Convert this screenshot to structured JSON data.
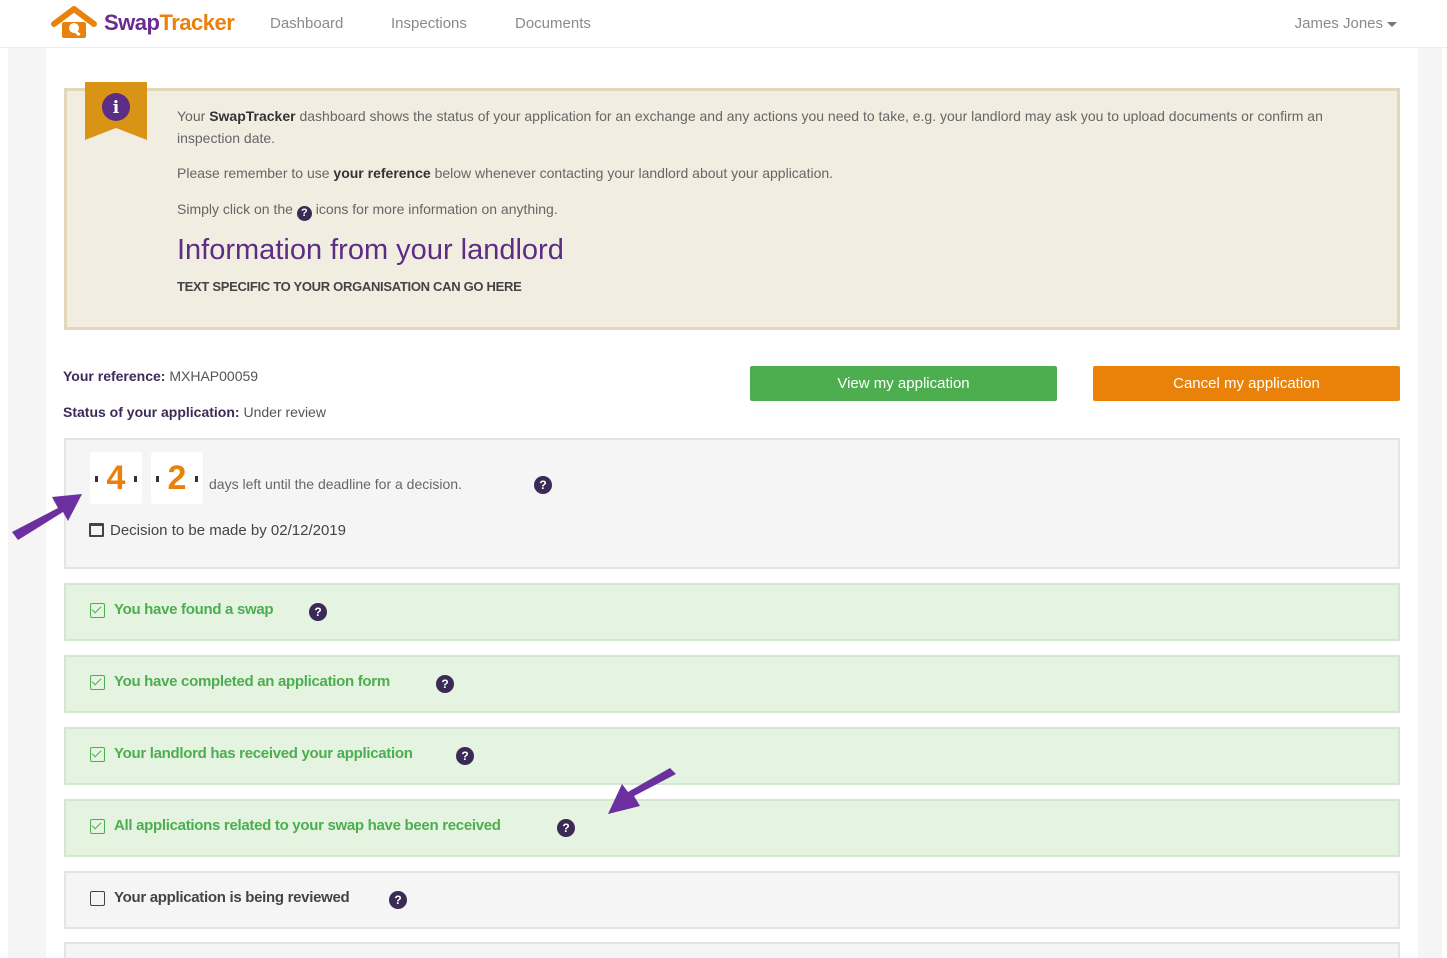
{
  "app": {
    "brand_part1": "Swap",
    "brand_part2": "Tracker"
  },
  "nav": {
    "items": [
      "Dashboard",
      "Inspections",
      "Documents"
    ],
    "user": "James Jones"
  },
  "info": {
    "para1_prefix": "Your ",
    "para1_brand": "SwapTracker",
    "para1_suffix": " dashboard shows the status of your application for an exchange and any actions you need to take, e.g. your landlord may ask you to upload documents or confirm an inspection date.",
    "para2_prefix": "Please remember to use ",
    "para2_bold": "your reference",
    "para2_suffix": " below whenever contacting your landlord about your application.",
    "para3_prefix": "Simply click on the ",
    "para3_suffix": " icons for more information on anything.",
    "heading": "Information from your landlord",
    "caps_text": "TEXT SPECIFIC TO YOUR ORGANISATION CAN GO HERE"
  },
  "reference": {
    "label": "Your reference:",
    "value": "MXHAP00059",
    "status_label": "Status of your application:",
    "status_value": "Under review"
  },
  "buttons": {
    "view": "View my application",
    "cancel": "Cancel my application"
  },
  "countdown": {
    "digit1": "4",
    "digit2": "2",
    "text": "days left until the deadline for a decision.",
    "decision": "Decision to be made by 02/12/2019"
  },
  "steps": [
    {
      "label": "You have found a swap",
      "done": true
    },
    {
      "label": "You have completed an application form",
      "done": true
    },
    {
      "label": "Your landlord has received your application",
      "done": true
    },
    {
      "label": "All applications related to your swap have been received",
      "done": true
    },
    {
      "label": "Your application is being reviewed",
      "done": false
    }
  ],
  "help_glyph": "?",
  "info_glyph": "i",
  "colors": {
    "brand_purple": "#6a2c91",
    "brand_orange": "#e8820c",
    "success_green": "#4cae4f",
    "arrow_purple": "#6b2fa0"
  }
}
